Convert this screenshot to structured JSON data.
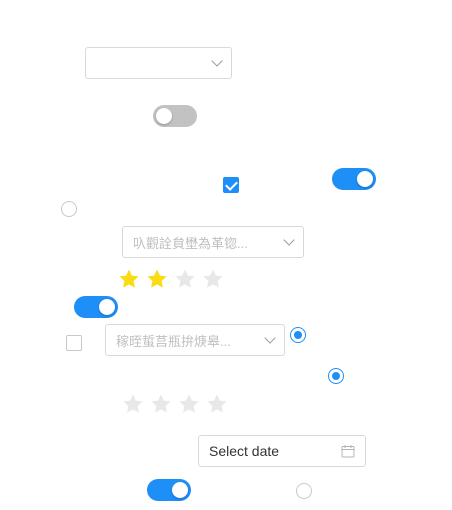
{
  "colors": {
    "accent": "#1f8ff8",
    "star_filled": "#fadb14",
    "star_empty": "#e8e8e8",
    "toggle_off": "#c2c2c2",
    "border": "#d9d9d9"
  },
  "selects": [
    {
      "placeholder": ""
    },
    {
      "placeholder": "叺觀詮貟壄為革锪..."
    },
    {
      "placeholder": "稼晊蜇莒瓶拚焿皋..."
    }
  ],
  "toggles": [
    {
      "on": false
    },
    {
      "on": true
    },
    {
      "on": true
    },
    {
      "on": true
    }
  ],
  "checkboxes": [
    {
      "checked": true
    },
    {
      "checked": false
    }
  ],
  "radios": [
    {
      "checked": false
    },
    {
      "checked": true
    },
    {
      "checked": true
    },
    {
      "checked": false
    }
  ],
  "ratings": [
    {
      "value": 2,
      "max": 4
    },
    {
      "value": 0,
      "max": 4
    }
  ],
  "datepicker": {
    "placeholder": "Select date",
    "icon": "calendar-icon"
  }
}
